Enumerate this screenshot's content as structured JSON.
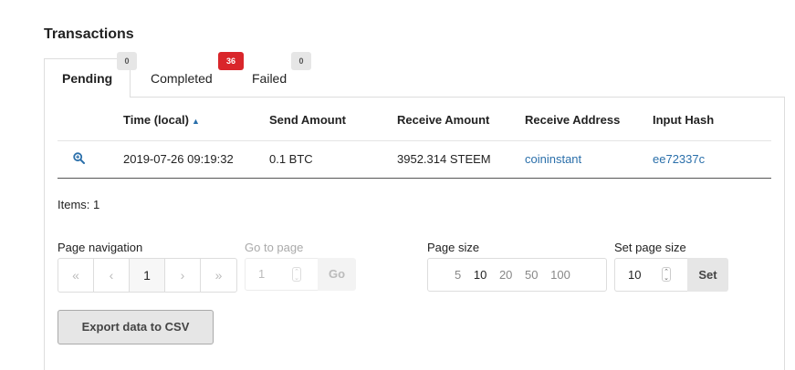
{
  "section_title": "Transactions",
  "tabs": [
    {
      "label": "Pending",
      "badge": "0",
      "active": true
    },
    {
      "label": "Completed",
      "badge": "36",
      "active": false
    },
    {
      "label": "Failed",
      "badge": "0",
      "active": false
    }
  ],
  "table": {
    "columns": [
      "Time (local)",
      "Send Amount",
      "Receive Amount",
      "Receive Address",
      "Input Hash"
    ],
    "sort_indicator": "▲",
    "rows": [
      {
        "time": "2019-07-26 09:19:32",
        "send": "0.1 BTC",
        "receive": "3952.314 STEEM",
        "address": "coininstant",
        "hash": "ee72337c"
      }
    ]
  },
  "items_text": "Items: 1",
  "pagination": {
    "label": "Page navigation",
    "first": "«",
    "prev": "‹",
    "current": "1",
    "next": "›",
    "last": "»"
  },
  "goto": {
    "label": "Go to page",
    "value": "1",
    "button": "Go"
  },
  "page_size": {
    "label": "Page size",
    "options": [
      "5",
      "10",
      "20",
      "50",
      "100"
    ],
    "selected": "10"
  },
  "set_page_size": {
    "label": "Set page size",
    "value": "10",
    "button": "Set"
  },
  "export_button": "Export data to CSV",
  "colors": {
    "accent": "#2a6faa",
    "badge_alert": "#d9262b",
    "badge_neutral": "#e6e6e6"
  },
  "icons": {
    "row_detail": "zoom-in-icon",
    "sort": "sort-up-icon"
  }
}
